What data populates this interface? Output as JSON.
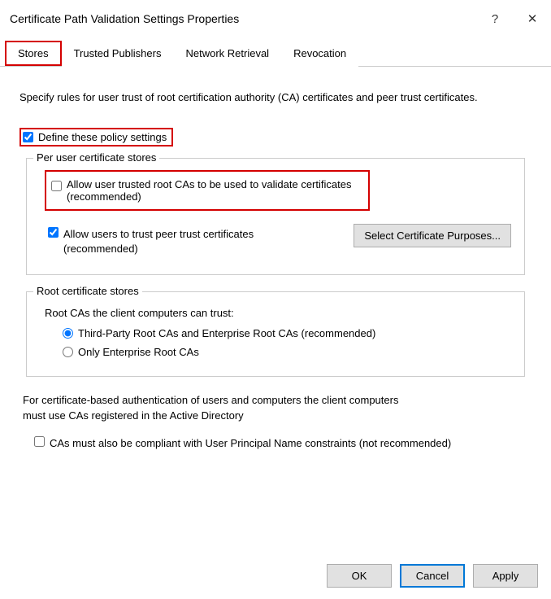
{
  "titlebar": {
    "title": "Certificate Path Validation Settings Properties",
    "help": "?",
    "close": "✕"
  },
  "tabs": {
    "stores": "Stores",
    "trusted_publishers": "Trusted Publishers",
    "network_retrieval": "Network Retrieval",
    "revocation": "Revocation"
  },
  "intro": "Specify rules for user trust of root certification authority (CA) certificates and peer trust certificates.",
  "define_label": "Define these policy settings",
  "group1": {
    "legend": "Per user certificate stores",
    "opt1": "Allow user trusted root CAs to be used to validate certificates (recommended)",
    "opt2": "Allow users to trust peer trust certificates (recommended)",
    "select_button": "Select Certificate Purposes..."
  },
  "group2": {
    "legend": "Root certificate stores",
    "subhead": "Root CAs the client computers can trust:",
    "radio1": "Third-Party Root CAs and Enterprise Root CAs (recommended)",
    "radio2": "Only Enterprise Root CAs"
  },
  "note": "For certificate-based authentication of users and computers the client computers must use CAs registered in the Active Directory",
  "upn_label": "CAs must also be compliant with User Principal Name constraints (not recommended)",
  "buttons": {
    "ok": "OK",
    "cancel": "Cancel",
    "apply": "Apply"
  }
}
